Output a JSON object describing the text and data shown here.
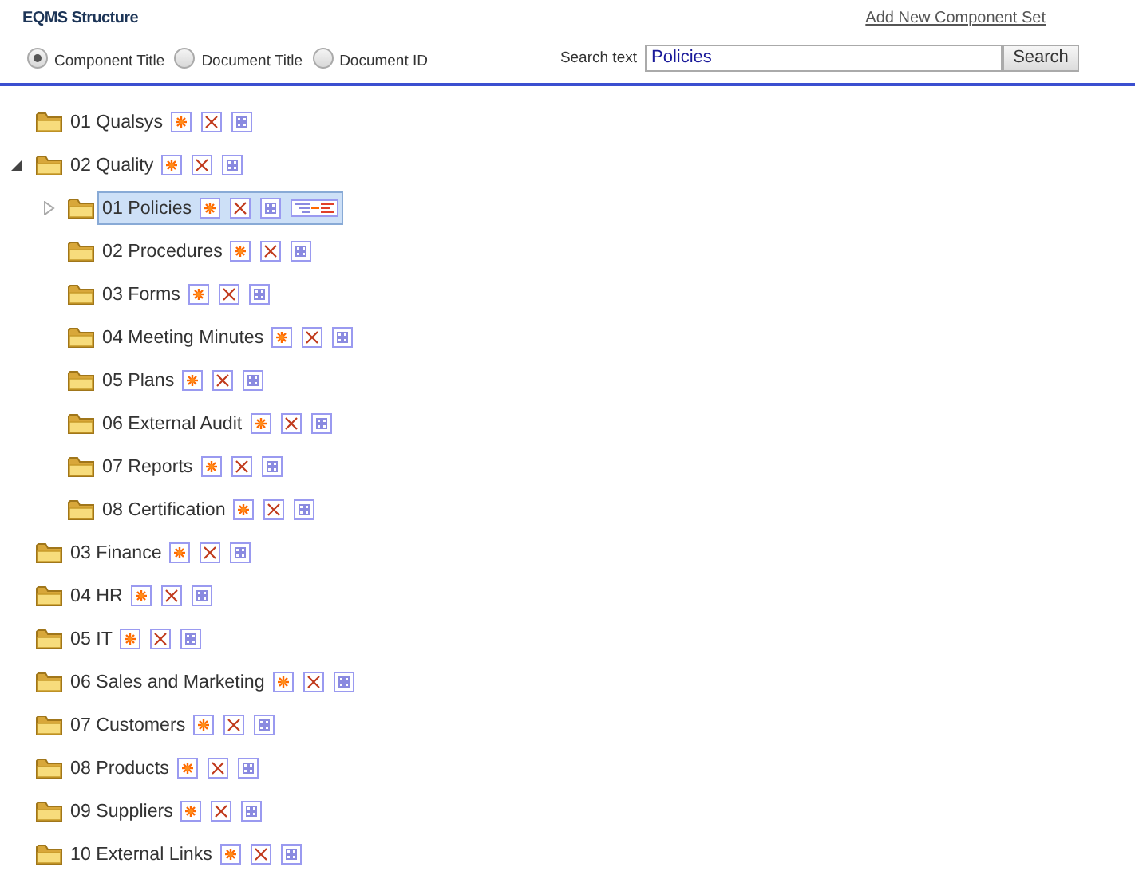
{
  "header": {
    "title": "EQMS Structure",
    "link": "Add New Component Set"
  },
  "search_options": [
    {
      "label": "Component Title",
      "selected": true
    },
    {
      "label": "Document Title",
      "selected": false
    },
    {
      "label": "Document ID",
      "selected": false
    }
  ],
  "search": {
    "label": "Search text",
    "value": "Policies",
    "button": "Search"
  },
  "tree": [
    {
      "label": "01 Qualsys",
      "expandable": false,
      "selected": false
    },
    {
      "label": "02 Quality",
      "expandable": true,
      "expanded": true,
      "selected": false,
      "children": [
        {
          "label": "01 Policies",
          "expandable": true,
          "expanded": false,
          "selected": true
        },
        {
          "label": "02 Procedures",
          "expandable": false,
          "selected": false
        },
        {
          "label": "03 Forms",
          "expandable": false,
          "selected": false
        },
        {
          "label": "04 Meeting Minutes",
          "expandable": false,
          "selected": false
        },
        {
          "label": "05 Plans",
          "expandable": false,
          "selected": false
        },
        {
          "label": "06 External Audit",
          "expandable": false,
          "selected": false
        },
        {
          "label": "07 Reports",
          "expandable": false,
          "selected": false
        },
        {
          "label": "08 Certification",
          "expandable": false,
          "selected": false
        }
      ]
    },
    {
      "label": "03 Finance",
      "expandable": false,
      "selected": false
    },
    {
      "label": "04 HR",
      "expandable": false,
      "selected": false
    },
    {
      "label": "05 IT",
      "expandable": false,
      "selected": false
    },
    {
      "label": "06 Sales and Marketing",
      "expandable": false,
      "selected": false
    },
    {
      "label": "07 Customers",
      "expandable": false,
      "selected": false
    },
    {
      "label": "08 Products",
      "expandable": false,
      "selected": false
    },
    {
      "label": "09 Suppliers",
      "expandable": false,
      "selected": false
    },
    {
      "label": "10 External Links",
      "expandable": false,
      "selected": false
    }
  ]
}
